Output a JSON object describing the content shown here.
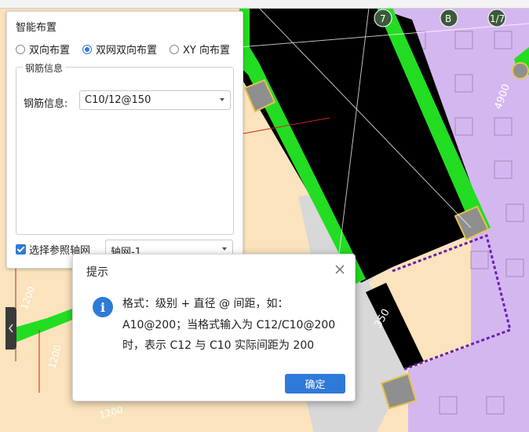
{
  "colors": {
    "accent": "#2f7ad8",
    "canvas_black": "#000000",
    "canvas_purple": "#d5b7f0",
    "canvas_beige": "#fae3bd",
    "canvas_green": "#22dd22",
    "canvas_gray": "#8f8f8f"
  },
  "canvas": {
    "grid_labels": [
      "7",
      "B",
      "1/7"
    ],
    "dimension_labels": [
      "4900",
      "1200",
      "1200",
      "1200",
      "350"
    ]
  },
  "panel": {
    "title": "智能布置",
    "radio_options": [
      {
        "label": "双向布置",
        "selected": false
      },
      {
        "label": "双网双向布置",
        "selected": true
      },
      {
        "label": "XY 向布置",
        "selected": false
      }
    ],
    "group_title": "钢筋信息",
    "rebar_label": "钢筋信息:",
    "rebar_value": "C10/12@150",
    "axis_checkbox_label": "选择参照轴网",
    "axis_checked": true,
    "axis_value": "轴网-1"
  },
  "dialog": {
    "title": "提示",
    "message_lines": [
      "格式：级别 + 直径 @ 间距，如：",
      "A10@200；当格式输入为 C12/C10@200",
      "时，表示 C12 与 C10 实际间距为 200"
    ],
    "ok_label": "确定",
    "icon": "info-icon",
    "close_icon": "close-icon"
  },
  "side_handle_icon": "chevron-left-icon"
}
